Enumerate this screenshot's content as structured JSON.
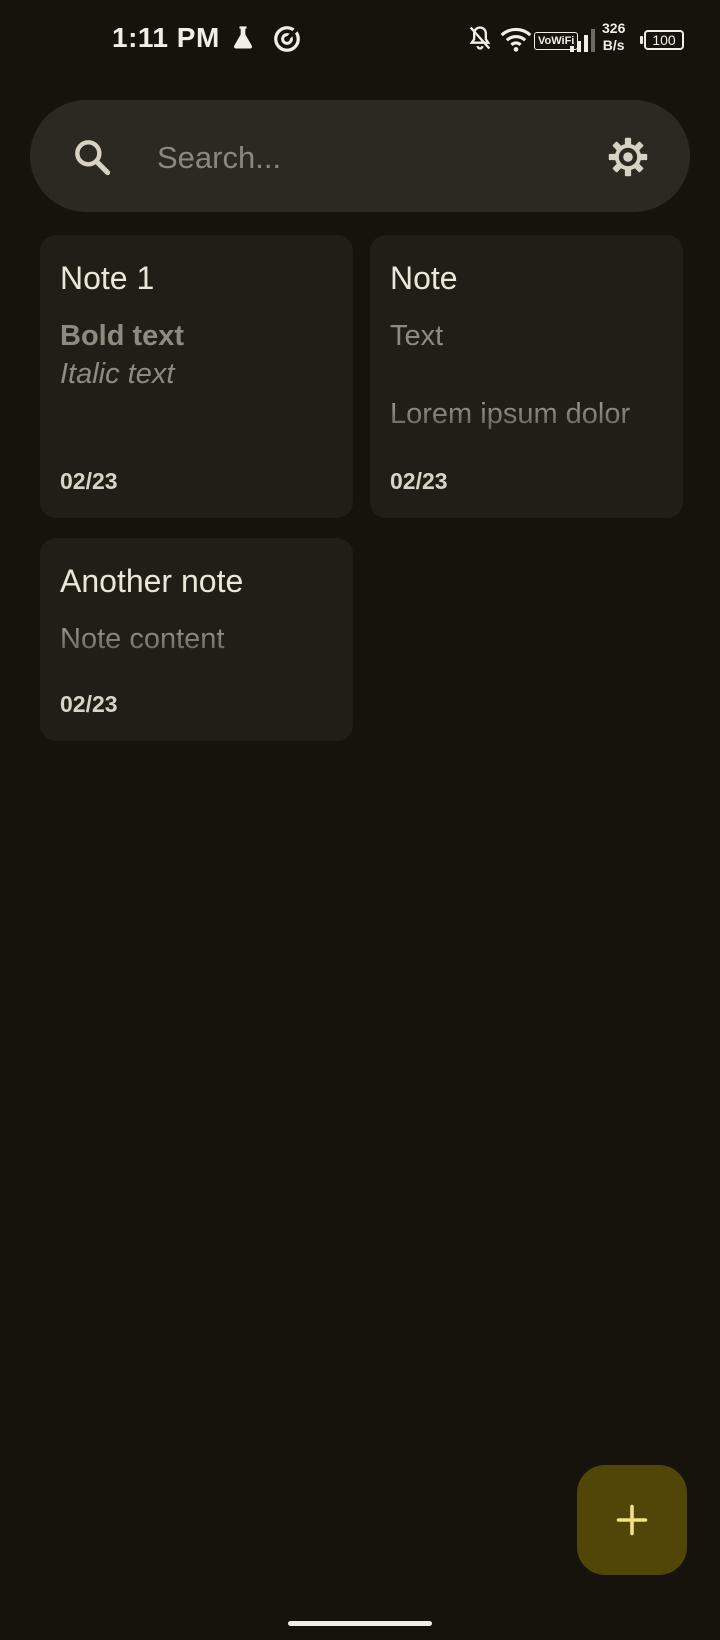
{
  "status_bar": {
    "time": "1:11 PM",
    "vowifi": "VoWiFi",
    "net_speed_value": "326",
    "net_speed_unit": "B/s",
    "battery": "100",
    "icons": [
      "flask-icon",
      "sync-icon",
      "bell-off-icon",
      "wifi-icon",
      "signal-icon"
    ]
  },
  "search": {
    "placeholder": "Search...",
    "value": ""
  },
  "notes": [
    {
      "title": "Note 1",
      "lines": [
        "Bold text",
        "Italic text"
      ],
      "date": "02/23"
    },
    {
      "title": "Note",
      "lines": [
        "Text",
        "Lorem ipsum dolor"
      ],
      "date": "02/23"
    },
    {
      "title": "Another note",
      "lines": [
        "Note content"
      ],
      "date": "02/23"
    }
  ],
  "fab": {
    "icon": "plus-icon",
    "label": "+"
  },
  "colors": {
    "background": "#16130d",
    "surface": "#211e18",
    "search_bar": "#2c2922",
    "fab": "#524508",
    "fab_icon": "#f3e08a"
  }
}
